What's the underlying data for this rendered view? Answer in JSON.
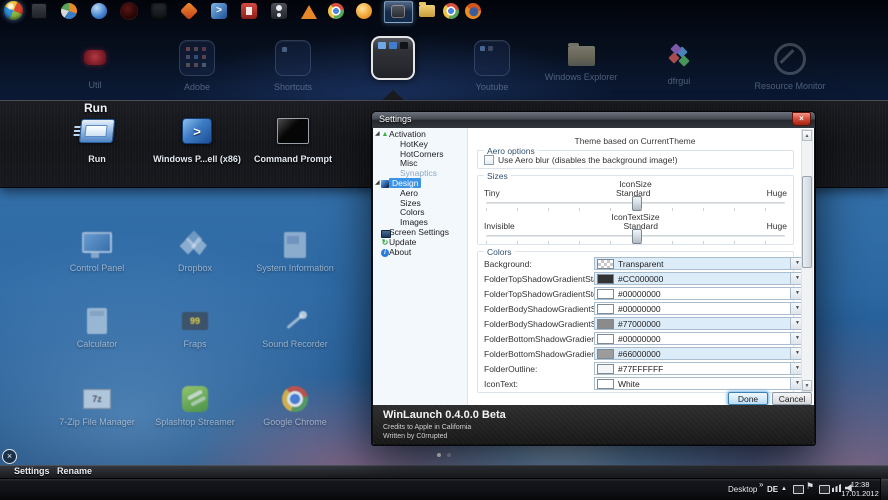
{
  "icons": {
    "close": "×",
    "expander": "◢",
    "activation_arrow": "▲",
    "update_arrow": "↻",
    "about_i": "i",
    "dropdown": "▼",
    "scroll_up": "▲",
    "scroll_down": "▼",
    "powershell_glyph": ">",
    "chevron_double": "»",
    "hidden_tray_arrow": "▲",
    "fraps_digits": "99",
    "sevenzip_glyph": "7z"
  },
  "launchpad": {
    "top_folders": [
      {
        "label": "Util"
      },
      {
        "label": "Adobe"
      },
      {
        "label": "Shortcuts"
      },
      {
        "label": "Run",
        "selected": true
      },
      {
        "label": "Youtube"
      },
      {
        "label": "Windows Explorer"
      },
      {
        "label": "dfrgui"
      },
      {
        "label": "Resource Monitor"
      }
    ],
    "open_folder": {
      "title": "Run",
      "items": [
        {
          "label": "Run"
        },
        {
          "label": "Windows P...ell (x86)"
        },
        {
          "label": "Command Prompt"
        }
      ]
    },
    "desktop_icons": [
      {
        "label": "Control Panel"
      },
      {
        "label": "Dropbox"
      },
      {
        "label": "System Information"
      },
      {
        "label": "Calculator"
      },
      {
        "label": "Fraps"
      },
      {
        "label": "Sound Recorder"
      },
      {
        "label": "7-Zip File Manager"
      },
      {
        "label": "Splashtop Streamer"
      },
      {
        "label": "Google Chrome"
      }
    ],
    "page_dot_count": 2,
    "actions": {
      "settings": "Settings",
      "rename": "Rename"
    }
  },
  "settings_window": {
    "title": "Settings",
    "tree": {
      "items": [
        {
          "label": "Activation"
        },
        {
          "label": "HotKey"
        },
        {
          "label": "HotCorners"
        },
        {
          "label": "Misc"
        },
        {
          "label": "Synaptics",
          "disabled": true
        },
        {
          "label": "Design",
          "selected": true
        },
        {
          "label": "Aero"
        },
        {
          "label": "Sizes"
        },
        {
          "label": "Colors"
        },
        {
          "label": "Images"
        },
        {
          "label": "Screen Settings"
        },
        {
          "label": "Update"
        },
        {
          "label": "About"
        }
      ]
    },
    "content": {
      "header": "Theme based on CurrentTheme",
      "aero": {
        "group_label": "Aero options",
        "checkbox_label": "Use Aero blur (disables the background image!)",
        "checked": false
      },
      "sizes": {
        "group_label": "Sizes",
        "icon_size": {
          "name": "IconSize",
          "min": "Tiny",
          "mid": "Standard",
          "max": "Huge",
          "value_percent": 50
        },
        "icon_text_size": {
          "name": "IconTextSize",
          "min": "Invisible",
          "mid": "Standard",
          "max": "Huge",
          "value_percent": 50
        }
      },
      "colors": {
        "group_label": "Colors",
        "rows": [
          {
            "label": "Background:",
            "value": "Transparent",
            "swatch": "checker"
          },
          {
            "label": "FolderTopShadowGradientStart:",
            "value": "#CC000000",
            "swatch": "#333333"
          },
          {
            "label": "FolderTopShadowGradientStop:",
            "value": "#00000000",
            "swatch": "#ffffff"
          },
          {
            "label": "FolderBodyShadowGradientStart:",
            "value": "#00000000",
            "swatch": "#ffffff"
          },
          {
            "label": "FolderBodyShadowGradientStop:",
            "value": "#77000000",
            "swatch": "#8b8b8b"
          },
          {
            "label": "FolderBottomShadowGradientStart:",
            "value": "#00000000",
            "swatch": "#ffffff"
          },
          {
            "label": "FolderBottomShadowGradientStop:",
            "value": "#66000000",
            "swatch": "#9c9c9c"
          },
          {
            "label": "FolderOutline:",
            "value": "#77FFFFFF",
            "swatch": "#f4f6f8"
          },
          {
            "label": "IconText:",
            "value": "White",
            "swatch": "#ffffff"
          }
        ]
      },
      "done_label": "Done",
      "cancel_label": "Cancel"
    },
    "footer": {
      "title": "WinLaunch 0.4.0.0 Beta",
      "credits": "Credits to Apple in California",
      "author": "Written by C0rrupted"
    }
  },
  "taskbar": {
    "icons": [
      "app-grid",
      "media-player",
      "globe-browser",
      "photoshop",
      "sk-app",
      "launcher-diamond",
      "powershell",
      "youtube-app",
      "person-app",
      "vlc",
      "chrome",
      "swirl-app",
      "winlaunch-active",
      "explorer-folder",
      "chrome-alt",
      "firefox"
    ],
    "tray": {
      "desktop_label": "Desktop",
      "language": "DE",
      "time": "12:38",
      "date": "17.01.2012"
    }
  }
}
